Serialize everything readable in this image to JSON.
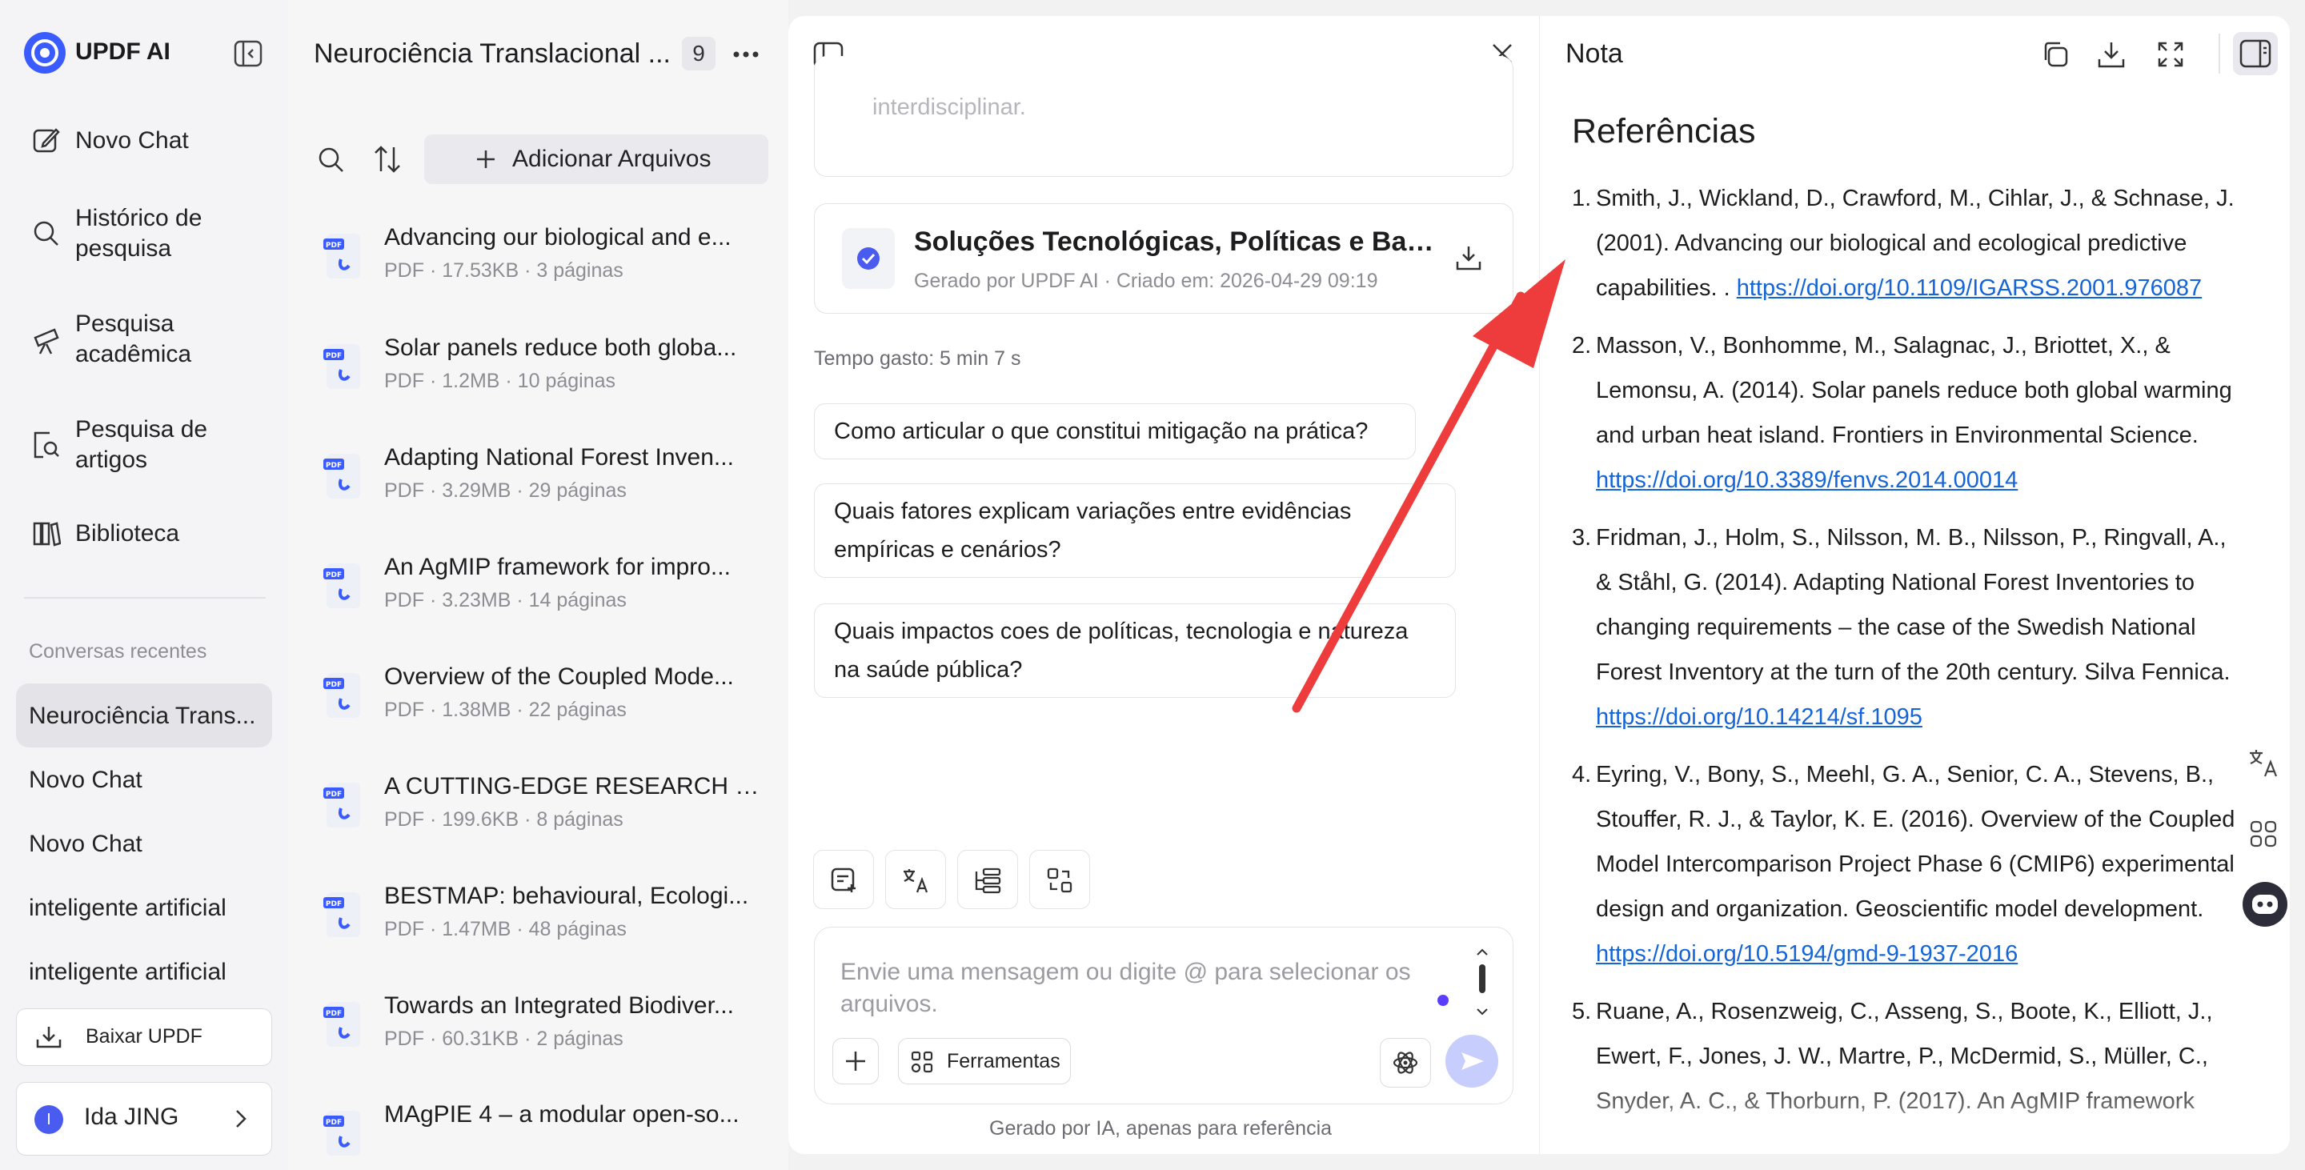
{
  "app": {
    "name": "UPDF AI"
  },
  "sidebar": {
    "nav": [
      {
        "label": "Novo Chat"
      },
      {
        "label": "Histórico de pesquisa"
      },
      {
        "label": "Pesquisa acadêmica"
      },
      {
        "label": "Pesquisa de artigos"
      },
      {
        "label": "Biblioteca"
      }
    ],
    "recent_title": "Conversas recentes",
    "recent": [
      {
        "label": "Neurociência Trans..."
      },
      {
        "label": "Novo Chat"
      },
      {
        "label": "Novo Chat"
      },
      {
        "label": "inteligente artificial"
      },
      {
        "label": "inteligente artificial"
      }
    ],
    "download_label": "Baixar UPDF",
    "user": {
      "initial": "I",
      "name": "Ida JING"
    }
  },
  "filelist": {
    "title": "Neurociência Translacional ...",
    "count": "9",
    "add_label": "Adicionar Arquivos",
    "files": [
      {
        "name": "Advancing our biological and e...",
        "meta": "PDF · 17.53KB · 3 páginas"
      },
      {
        "name": "Solar panels reduce both globa...",
        "meta": "PDF · 1.2MB · 10 páginas"
      },
      {
        "name": "Adapting National Forest Inven...",
        "meta": "PDF · 3.29MB · 29 páginas"
      },
      {
        "name": "An AgMIP framework for impro...",
        "meta": "PDF · 3.23MB · 14 páginas"
      },
      {
        "name": "Overview of the Coupled Mode...",
        "meta": "PDF · 1.38MB · 22 páginas"
      },
      {
        "name": "A CUTTING-EDGE RESEARCH O...",
        "meta": "PDF · 199.6KB · 8 páginas"
      },
      {
        "name": "BESTMAP: behavioural, Ecologi...",
        "meta": "PDF · 1.47MB · 48 páginas"
      },
      {
        "name": "Towards an Integrated Biodiver...",
        "meta": "PDF · 60.31KB · 2 páginas"
      },
      {
        "name": "MAgPIE 4 – a modular open-so...",
        "meta": ""
      }
    ]
  },
  "chat": {
    "faded_text": "interdisciplinar.",
    "doc": {
      "title": "Soluções Tecnológicas, Políticas e Base...",
      "meta": "Gerado por UPDF AI · Criado em: 2026-04-29 09:19"
    },
    "time_spent": "Tempo gasto: 5 min 7 s",
    "suggestions": [
      {
        "text": "Como articular o que constitui mitigação na prática?"
      },
      {
        "text": "Quais fatores explicam variações entre evidências empíricas e cenários?"
      },
      {
        "text": "Quais impactos coes de políticas, tecnologia e natureza na saúde pública?"
      }
    ],
    "input_placeholder": "Envie uma mensagem ou digite @ para selecionar os arquivos.",
    "tools_label": "Ferramentas",
    "footer": "Gerado por IA, apenas para referência"
  },
  "note": {
    "title": "Nota",
    "heading": "Referências",
    "refs": [
      {
        "num": "1.",
        "text": "Smith, J., Wickland, D., Crawford, M., Cihlar, J., & Schnase, J. (2001). Advancing our biological and ecological predictive capabilities. . ",
        "link": "https://doi.org/10.1109/IGARSS.2001.976087"
      },
      {
        "num": "2.",
        "text": "Masson, V., Bonhomme, M., Salagnac, J., Briottet, X., & Lemonsu, A. (2014). Solar panels reduce both global warming and urban heat island. Frontiers in Environmental Science. ",
        "link": "https://doi.org/10.3389/fenvs.2014.00014"
      },
      {
        "num": "3.",
        "text": "Fridman, J., Holm, S., Nilsson, M. B., Nilsson, P., Ringvall, A., & Ståhl, G. (2014). Adapting National Forest Inventories to changing requirements – the case of the Swedish National Forest Inventory at the turn of the 20th century. Silva Fennica. ",
        "link": "https://doi.org/10.14214/sf.1095"
      },
      {
        "num": "4.",
        "text": "Eyring, V., Bony, S., Meehl, G. A., Senior, C. A., Stevens, B., Stouffer, R. J., & Taylor, K. E. (2016). Overview of the Coupled Model Intercomparison Project Phase 6 (CMIP6) experimental design and organization. Geoscientific model development. ",
        "link": "https://doi.org/10.5194/gmd-9-1937-2016"
      },
      {
        "num": "5.",
        "text": "Ruane, A., Rosenzweig, C., Asseng, S., Boote, K., Elliott, J., Ewert, F., Jones, J. W., Martre, P., McDermid, S., Müller, C., Snyder, A. C., & Thorburn, P. (2017). An AgMIP framework",
        "link": ""
      }
    ]
  },
  "colors": {
    "accent": "#3a5bff",
    "link": "#1565d8",
    "arrow": "#ee3b3b"
  }
}
